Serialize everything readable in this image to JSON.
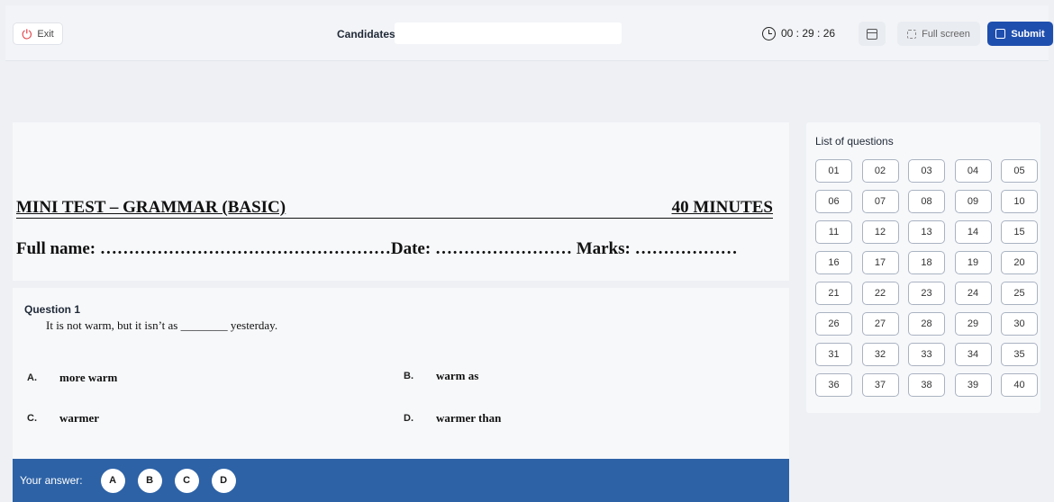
{
  "topbar": {
    "exit_label": "Exit",
    "candidates_label": "Candidates:",
    "candidates_value": "",
    "timer": "00 : 29 : 26",
    "fullscreen_label": "Full screen",
    "submit_label": "Submit"
  },
  "paper": {
    "title_left": "MINI TEST – GRAMMAR (BASIC)",
    "title_right": "40 MINUTES",
    "info_line": "Full name: ……………………………………………Date: …………………… Marks: ………………"
  },
  "question": {
    "heading": "Question 1",
    "text": "It is not warm, but it isn’t as ________ yesterday.",
    "options": [
      {
        "letter": "A.",
        "text": "more warm"
      },
      {
        "letter": "B.",
        "text": "warm as"
      },
      {
        "letter": "C.",
        "text": "warmer"
      },
      {
        "letter": "D.",
        "text": "warmer than"
      }
    ]
  },
  "answer_bar": {
    "label": "Your answer:",
    "choices": [
      "A",
      "B",
      "C",
      "D"
    ]
  },
  "question_list": {
    "title": "List of questions",
    "numbers": [
      "01",
      "02",
      "03",
      "04",
      "05",
      "06",
      "07",
      "08",
      "09",
      "10",
      "11",
      "12",
      "13",
      "14",
      "15",
      "16",
      "17",
      "18",
      "19",
      "20",
      "21",
      "22",
      "23",
      "24",
      "25",
      "26",
      "27",
      "28",
      "29",
      "30",
      "31",
      "32",
      "33",
      "34",
      "35",
      "36",
      "37",
      "38",
      "39",
      "40"
    ]
  },
  "colors": {
    "accent": "#1f4fae",
    "answer_bar": "#2d62a6",
    "exit_icon": "#e0343b"
  }
}
